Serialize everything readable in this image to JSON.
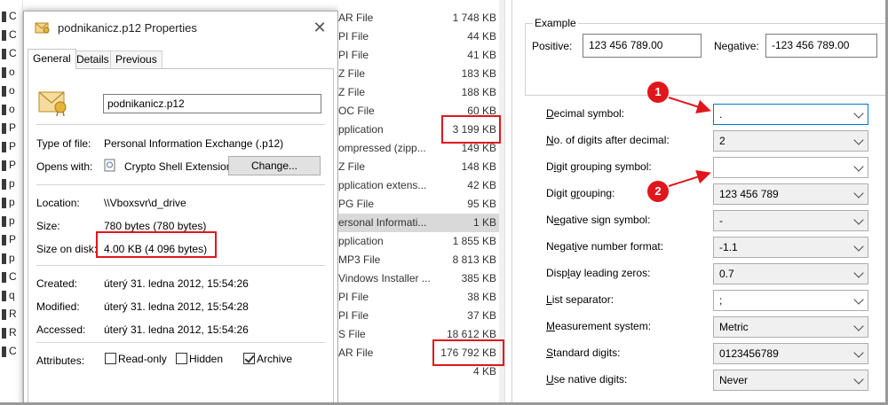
{
  "left_strip": {
    "rows": [
      "C",
      "C",
      "C",
      "o",
      "o",
      "o",
      "P",
      "P",
      "P",
      "p",
      "p",
      "p",
      "P",
      "p",
      "C",
      "q",
      "R",
      "R",
      "C"
    ]
  },
  "dialog": {
    "title": "podnikanicz.p12 Properties",
    "close_glyph": "✕",
    "tabs": [
      "General",
      "Details",
      "Previous Versions"
    ],
    "file_name": "podnikanicz.p12",
    "type_label": "Type of file:",
    "type_value": "Personal Information Exchange (.p12)",
    "opens_label": "Opens with:",
    "opens_value": "Crypto Shell Extension",
    "change_label": "Change...",
    "location_label": "Location:",
    "location_value": "\\\\Vboxsvr\\d_drive",
    "size_label": "Size:",
    "size_value": "780 bytes (780 bytes)",
    "size_disk_label": "Size on disk:",
    "size_disk_value": "4.00 KB (4 096 bytes)",
    "created_label": "Created:",
    "created_value": "úterý 31. ledna 2012, 15:54:26",
    "modified_label": "Modified:",
    "modified_value": "úterý 31. ledna 2012, 15:54:28",
    "accessed_label": "Accessed:",
    "accessed_value": "úterý 31. ledna 2012, 15:54:26",
    "attributes_label": "Attributes:",
    "readonly_label": "Read-only",
    "hidden_label": "Hidden",
    "archive_label": "Archive"
  },
  "file_list": {
    "rows": [
      {
        "type": "AR File",
        "size": "1 748 KB"
      },
      {
        "type": "PI File",
        "size": "44 KB"
      },
      {
        "type": "PI File",
        "size": "41 KB"
      },
      {
        "type": "Z File",
        "size": "183 KB"
      },
      {
        "type": "Z File",
        "size": "188 KB"
      },
      {
        "type": "OC File",
        "size": "60 KB"
      },
      {
        "type": "pplication",
        "size": "3 199 KB"
      },
      {
        "type": "ompressed (zipp...",
        "size": "149 KB"
      },
      {
        "type": "Z File",
        "size": "148 KB"
      },
      {
        "type": "pplication extens...",
        "size": "42 KB"
      },
      {
        "type": "PG File",
        "size": "95 KB"
      },
      {
        "type": "ersonal Informati...",
        "size": "1 KB"
      },
      {
        "type": "pplication",
        "size": "1 855 KB"
      },
      {
        "type": "MP3 File",
        "size": "8 813 KB"
      },
      {
        "type": "Vindows Installer ...",
        "size": "385 KB"
      },
      {
        "type": "PI File",
        "size": "38 KB"
      },
      {
        "type": "PI File",
        "size": "37 KB"
      },
      {
        "type": "S File",
        "size": "18 612 KB"
      },
      {
        "type": "AR File",
        "size": "176 792 KB"
      },
      {
        "type": "",
        "size": "4 KB"
      }
    ]
  },
  "region": {
    "example_legend": "Example",
    "positive_label": "Positive:",
    "positive_value": "123 456 789.00",
    "negative_label": "Negative:",
    "negative_value": "-123 456 789.00",
    "settings": [
      {
        "pre": "",
        "key": "D",
        "post": "ecimal symbol:",
        "value": "."
      },
      {
        "pre": "",
        "key": "N",
        "post": "o. of digits after decimal:",
        "value": "2"
      },
      {
        "pre": "D",
        "key": "i",
        "post": "git grouping symbol:",
        "value": ""
      },
      {
        "pre": "Digit g",
        "key": "r",
        "post": "ouping:",
        "value": "123 456 789"
      },
      {
        "pre": "N",
        "key": "e",
        "post": "gative sign symbol:",
        "value": "-"
      },
      {
        "pre": "Negat",
        "key": "i",
        "post": "ve number format:",
        "value": "-1.1"
      },
      {
        "pre": "Disp",
        "key": "l",
        "post": "ay leading zeros:",
        "value": "0.7"
      },
      {
        "pre": "",
        "key": "L",
        "post": "ist separator:",
        "value": ";"
      },
      {
        "pre": "",
        "key": "M",
        "post": "easurement system:",
        "value": "Metric"
      },
      {
        "pre": "",
        "key": "S",
        "post": "tandard digits:",
        "value": "0123456789"
      },
      {
        "pre": "",
        "key": "U",
        "post": "se native digits:",
        "value": "Never"
      }
    ],
    "callout_1": "1",
    "callout_2": "2"
  },
  "colors": {
    "highlight_red": "#e0161d",
    "focus_blue": "#0078d7"
  }
}
